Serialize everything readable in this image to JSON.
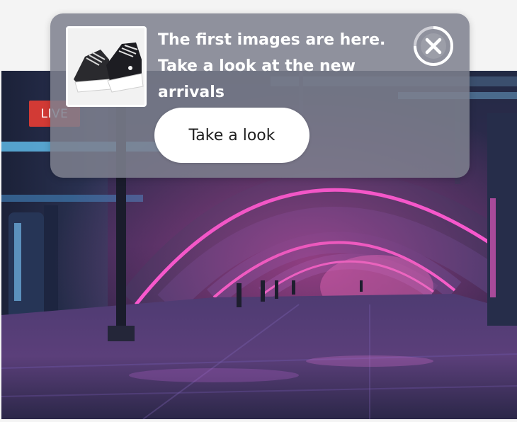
{
  "stream": {
    "live_label": "LIVE"
  },
  "notification": {
    "product_image_icon": "sneakers-thumbnail",
    "message": "The first images are here. Take a look at the new arrivals",
    "cta_label": "Take a look",
    "close_icon": "close-icon",
    "colors": {
      "overlay": "#7e808e",
      "text": "#ffffff",
      "button_bg": "#ffffff",
      "live_badge": "#d23a35"
    }
  }
}
